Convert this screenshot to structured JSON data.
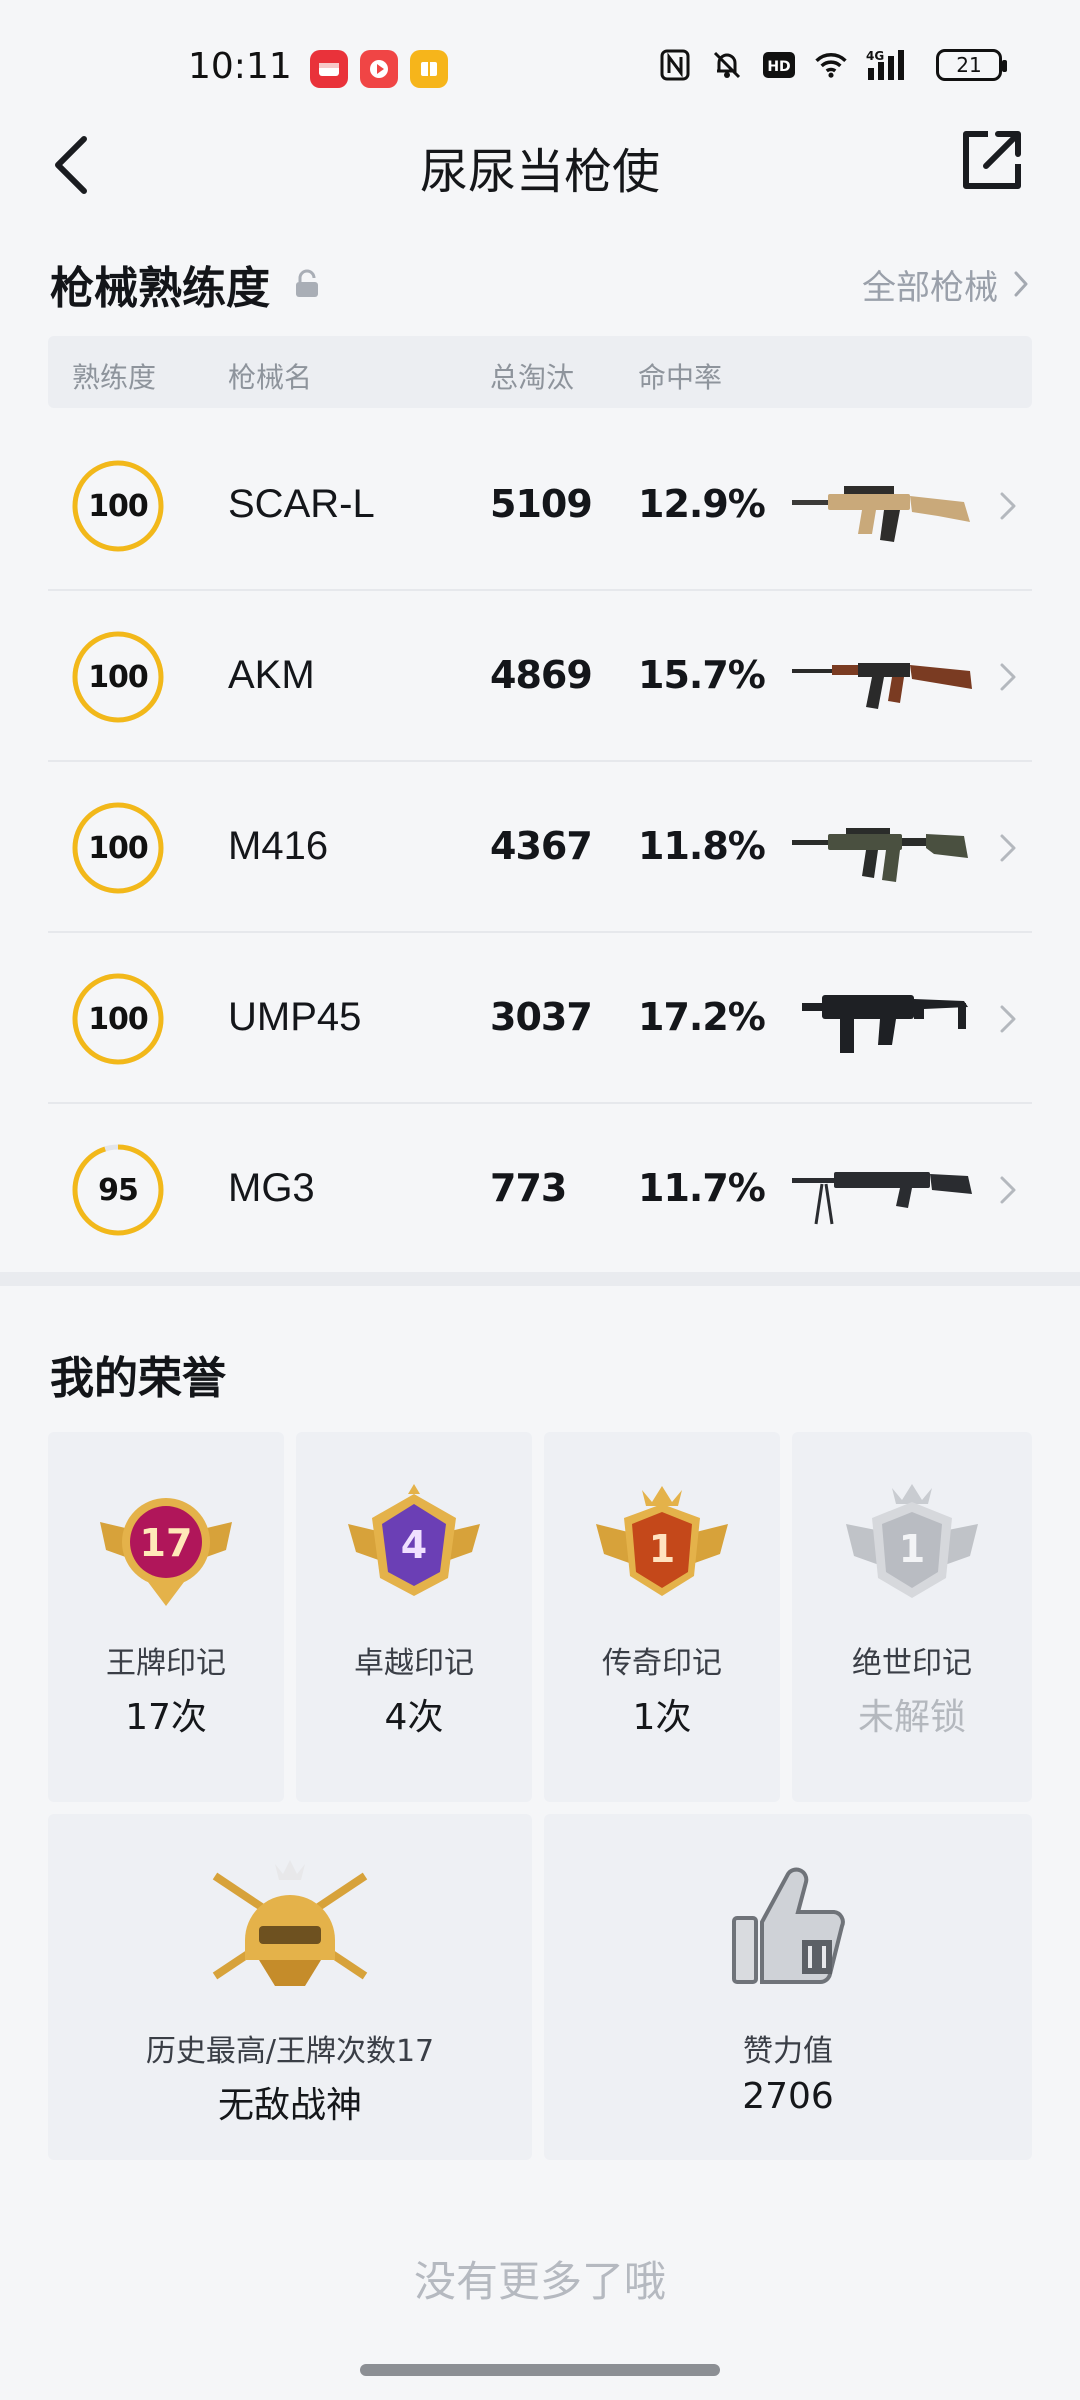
{
  "status_bar": {
    "time": "10:11",
    "network": "4G",
    "battery": "21"
  },
  "header": {
    "title": "尿尿当枪使"
  },
  "mastery": {
    "title": "枪械熟练度",
    "all_link": "全部枪械",
    "columns": [
      "熟练度",
      "枪械名",
      "总淘汰",
      "命中率"
    ],
    "rows": [
      {
        "level": "100",
        "progress": 1.0,
        "name": "SCAR-L",
        "kills": "5109",
        "rate": "12.9%",
        "icon": "scar-l-rifle-icon",
        "color": "#c9a97a"
      },
      {
        "level": "100",
        "progress": 1.0,
        "name": "AKM",
        "kills": "4869",
        "rate": "15.7%",
        "icon": "akm-rifle-icon",
        "color": "#7a3b22"
      },
      {
        "level": "100",
        "progress": 1.0,
        "name": "M416",
        "kills": "4367",
        "rate": "11.8%",
        "icon": "m416-rifle-icon",
        "color": "#4a5040"
      },
      {
        "level": "100",
        "progress": 1.0,
        "name": "UMP45",
        "kills": "3037",
        "rate": "17.2%",
        "icon": "ump45-smg-icon",
        "color": "#1e2024"
      },
      {
        "level": "95",
        "progress": 0.95,
        "name": "MG3",
        "kills": "773",
        "rate": "11.7%",
        "icon": "mg3-lmg-icon",
        "color": "#2a2c30"
      }
    ]
  },
  "honors": {
    "title": "我的荣誉",
    "badges": [
      {
        "number": "17",
        "label": "王牌印记",
        "value": "17次",
        "locked": false,
        "color": "#b0165a"
      },
      {
        "number": "4",
        "label": "卓越印记",
        "value": "4次",
        "locked": false,
        "color": "#6b3fb5"
      },
      {
        "number": "1",
        "label": "传奇印记",
        "value": "1次",
        "locked": false,
        "color": "#c4481a"
      },
      {
        "number": "1",
        "label": "绝世印记",
        "value": "未解锁",
        "locked": true,
        "color": "#b9bcc2"
      }
    ],
    "highest": {
      "label": "历史最高/王牌次数17",
      "value": "无敌战神"
    },
    "likes": {
      "label": "赞力值",
      "value": "2706"
    }
  },
  "footer": {
    "no_more": "没有更多了哦"
  },
  "colors": {
    "ring": "#f2b81a",
    "ring_track": "#e3e5ea",
    "gold": "#d7a23a"
  }
}
